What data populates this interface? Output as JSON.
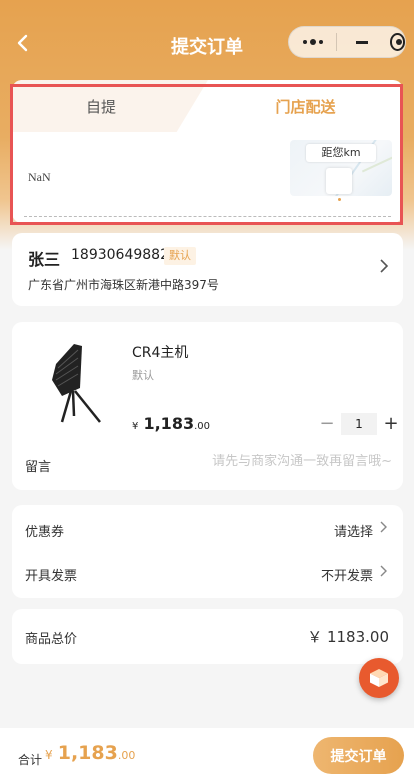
{
  "nav": {
    "back_icon": "chevron-left-icon",
    "title": "提交订单",
    "capsule": {
      "more_icon": "more-dots-icon",
      "minimize_icon": "minimize-icon",
      "close_icon": "target-icon"
    }
  },
  "delivery": {
    "tabs": [
      {
        "label": "自提",
        "active": false
      },
      {
        "label": "门店配送",
        "active": true
      }
    ],
    "store_text": "NaN",
    "map_label": "距您km"
  },
  "address": {
    "name": "张三",
    "phone": "18930649882",
    "default_tag": "默认",
    "detail": "广东省广州市海珠区新港中路397号"
  },
  "product": {
    "name": "CR4主机",
    "spec": "默认",
    "price_symbol": "¥",
    "price_int": "1,183",
    "price_dec": ".00",
    "quantity": "1",
    "minus": "−",
    "plus": "+"
  },
  "remark": {
    "label": "留言",
    "placeholder": "请先与商家沟通一致再留言哦~"
  },
  "options": {
    "coupon_label": "优惠券",
    "coupon_value": "请选择",
    "invoice_label": "开具发票",
    "invoice_value": "不开发票"
  },
  "total": {
    "label": "商品总价",
    "value": "￥ 1183.00"
  },
  "footer": {
    "sum_label": "合计",
    "price_symbol": "¥",
    "price_int": "1,183",
    "price_dec": ".00",
    "submit_label": "提交订单"
  },
  "colors": {
    "accent": "#e6a24f",
    "highlight": "#e85454",
    "float_button": "#e85a2e"
  }
}
